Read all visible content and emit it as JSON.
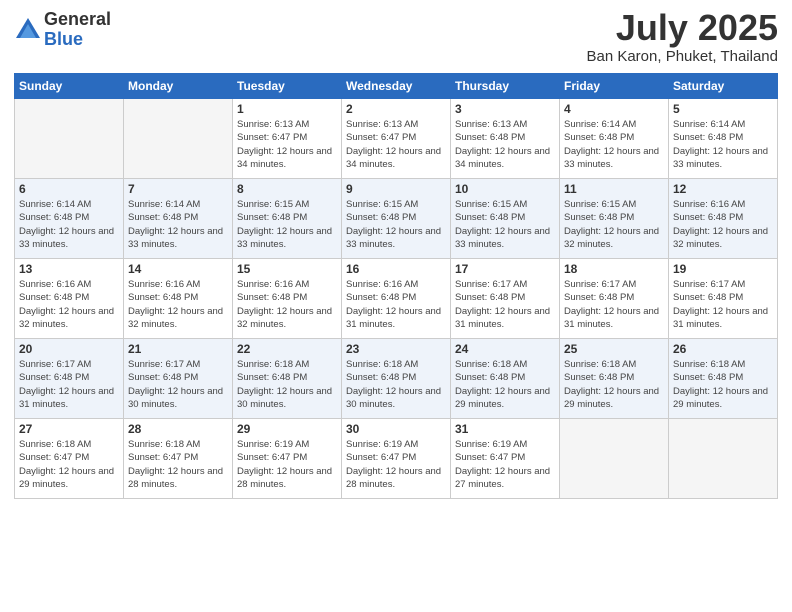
{
  "logo": {
    "general": "General",
    "blue": "Blue"
  },
  "title": "July 2025",
  "location": "Ban Karon, Phuket, Thailand",
  "days_of_week": [
    "Sunday",
    "Monday",
    "Tuesday",
    "Wednesday",
    "Thursday",
    "Friday",
    "Saturday"
  ],
  "weeks": [
    [
      {
        "day": "",
        "info": ""
      },
      {
        "day": "",
        "info": ""
      },
      {
        "day": "1",
        "info": "Sunrise: 6:13 AM\nSunset: 6:47 PM\nDaylight: 12 hours and 34 minutes."
      },
      {
        "day": "2",
        "info": "Sunrise: 6:13 AM\nSunset: 6:47 PM\nDaylight: 12 hours and 34 minutes."
      },
      {
        "day": "3",
        "info": "Sunrise: 6:13 AM\nSunset: 6:48 PM\nDaylight: 12 hours and 34 minutes."
      },
      {
        "day": "4",
        "info": "Sunrise: 6:14 AM\nSunset: 6:48 PM\nDaylight: 12 hours and 33 minutes."
      },
      {
        "day": "5",
        "info": "Sunrise: 6:14 AM\nSunset: 6:48 PM\nDaylight: 12 hours and 33 minutes."
      }
    ],
    [
      {
        "day": "6",
        "info": "Sunrise: 6:14 AM\nSunset: 6:48 PM\nDaylight: 12 hours and 33 minutes."
      },
      {
        "day": "7",
        "info": "Sunrise: 6:14 AM\nSunset: 6:48 PM\nDaylight: 12 hours and 33 minutes."
      },
      {
        "day": "8",
        "info": "Sunrise: 6:15 AM\nSunset: 6:48 PM\nDaylight: 12 hours and 33 minutes."
      },
      {
        "day": "9",
        "info": "Sunrise: 6:15 AM\nSunset: 6:48 PM\nDaylight: 12 hours and 33 minutes."
      },
      {
        "day": "10",
        "info": "Sunrise: 6:15 AM\nSunset: 6:48 PM\nDaylight: 12 hours and 33 minutes."
      },
      {
        "day": "11",
        "info": "Sunrise: 6:15 AM\nSunset: 6:48 PM\nDaylight: 12 hours and 32 minutes."
      },
      {
        "day": "12",
        "info": "Sunrise: 6:16 AM\nSunset: 6:48 PM\nDaylight: 12 hours and 32 minutes."
      }
    ],
    [
      {
        "day": "13",
        "info": "Sunrise: 6:16 AM\nSunset: 6:48 PM\nDaylight: 12 hours and 32 minutes."
      },
      {
        "day": "14",
        "info": "Sunrise: 6:16 AM\nSunset: 6:48 PM\nDaylight: 12 hours and 32 minutes."
      },
      {
        "day": "15",
        "info": "Sunrise: 6:16 AM\nSunset: 6:48 PM\nDaylight: 12 hours and 32 minutes."
      },
      {
        "day": "16",
        "info": "Sunrise: 6:16 AM\nSunset: 6:48 PM\nDaylight: 12 hours and 31 minutes."
      },
      {
        "day": "17",
        "info": "Sunrise: 6:17 AM\nSunset: 6:48 PM\nDaylight: 12 hours and 31 minutes."
      },
      {
        "day": "18",
        "info": "Sunrise: 6:17 AM\nSunset: 6:48 PM\nDaylight: 12 hours and 31 minutes."
      },
      {
        "day": "19",
        "info": "Sunrise: 6:17 AM\nSunset: 6:48 PM\nDaylight: 12 hours and 31 minutes."
      }
    ],
    [
      {
        "day": "20",
        "info": "Sunrise: 6:17 AM\nSunset: 6:48 PM\nDaylight: 12 hours and 31 minutes."
      },
      {
        "day": "21",
        "info": "Sunrise: 6:17 AM\nSunset: 6:48 PM\nDaylight: 12 hours and 30 minutes."
      },
      {
        "day": "22",
        "info": "Sunrise: 6:18 AM\nSunset: 6:48 PM\nDaylight: 12 hours and 30 minutes."
      },
      {
        "day": "23",
        "info": "Sunrise: 6:18 AM\nSunset: 6:48 PM\nDaylight: 12 hours and 30 minutes."
      },
      {
        "day": "24",
        "info": "Sunrise: 6:18 AM\nSunset: 6:48 PM\nDaylight: 12 hours and 29 minutes."
      },
      {
        "day": "25",
        "info": "Sunrise: 6:18 AM\nSunset: 6:48 PM\nDaylight: 12 hours and 29 minutes."
      },
      {
        "day": "26",
        "info": "Sunrise: 6:18 AM\nSunset: 6:48 PM\nDaylight: 12 hours and 29 minutes."
      }
    ],
    [
      {
        "day": "27",
        "info": "Sunrise: 6:18 AM\nSunset: 6:47 PM\nDaylight: 12 hours and 29 minutes."
      },
      {
        "day": "28",
        "info": "Sunrise: 6:18 AM\nSunset: 6:47 PM\nDaylight: 12 hours and 28 minutes."
      },
      {
        "day": "29",
        "info": "Sunrise: 6:19 AM\nSunset: 6:47 PM\nDaylight: 12 hours and 28 minutes."
      },
      {
        "day": "30",
        "info": "Sunrise: 6:19 AM\nSunset: 6:47 PM\nDaylight: 12 hours and 28 minutes."
      },
      {
        "day": "31",
        "info": "Sunrise: 6:19 AM\nSunset: 6:47 PM\nDaylight: 12 hours and 27 minutes."
      },
      {
        "day": "",
        "info": ""
      },
      {
        "day": "",
        "info": ""
      }
    ]
  ]
}
